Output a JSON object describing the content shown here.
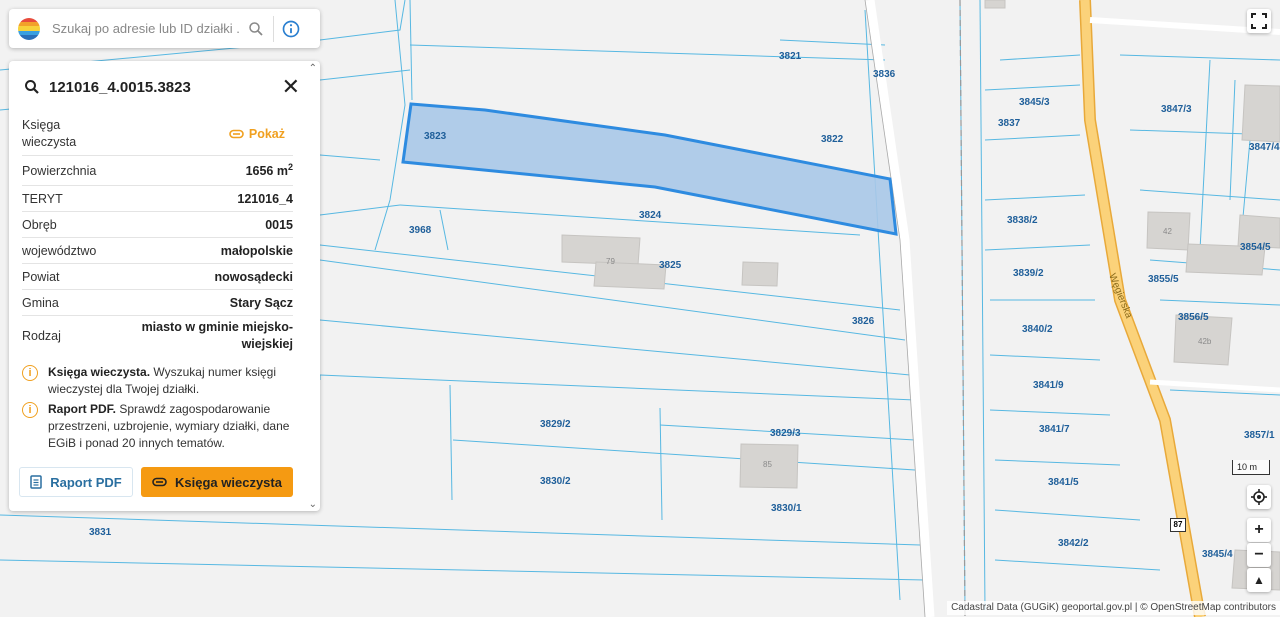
{
  "search": {
    "placeholder": "Szukaj po adresie lub ID działki ..."
  },
  "panel": {
    "title": "121016_4.0015.3823",
    "rows": [
      {
        "key": "Księga wieczysta",
        "link": "Pokaż"
      },
      {
        "key": "Powierzchnia",
        "value": "1656 m",
        "sup": "2"
      },
      {
        "key": "TERYT",
        "value": "121016_4"
      },
      {
        "key": "Obręb",
        "value": "0015"
      },
      {
        "key": "województwo",
        "value": "małopolskie"
      },
      {
        "key": "Powiat",
        "value": "nowosądecki"
      },
      {
        "key": "Gmina",
        "value": "Stary Sącz"
      },
      {
        "key": "Rodzaj",
        "value": "miasto w gminie miejsko-wiejskiej"
      }
    ],
    "info": [
      {
        "bold": "Księga wieczysta.",
        "text": " Wyszukaj numer księgi wieczystej dla Twojej działki."
      },
      {
        "bold": "Raport PDF.",
        "text": " Sprawdź zagospodarowanie przestrzeni, uzbrojenie, wymiary działki, dane EGiB i ponad 20 innych tematów."
      }
    ],
    "buttons": {
      "pdf": "Raport PDF",
      "kw": "Księga wieczysta"
    }
  },
  "map": {
    "parcels": [
      "3823",
      "3821",
      "3822",
      "3824",
      "3825",
      "3826",
      "3968",
      "3836",
      "3829/2",
      "3829/3",
      "3830/2",
      "3830/1",
      "3831",
      "3837",
      "3845/3",
      "3847/3",
      "3847/4",
      "3838/2",
      "3839/2",
      "3840/2",
      "3841/9",
      "3841/7",
      "3841/5",
      "3842/2",
      "3845/4",
      "3854/5",
      "3855/5",
      "3856/5",
      "3857/1"
    ],
    "house_numbers": [
      "79",
      "85",
      "42",
      "42b"
    ],
    "street": "Węgierska",
    "road_number": "87",
    "scale": "10 m"
  },
  "colors": {
    "accent": "#f59a12",
    "parcel_fill": "#a9c8e8",
    "parcel_stroke": "#2e8be0",
    "lines": "#4bb3e0"
  },
  "attribution": "Cadastral Data (GUGiK) geoportal.gov.pl | © OpenStreetMap contributors"
}
